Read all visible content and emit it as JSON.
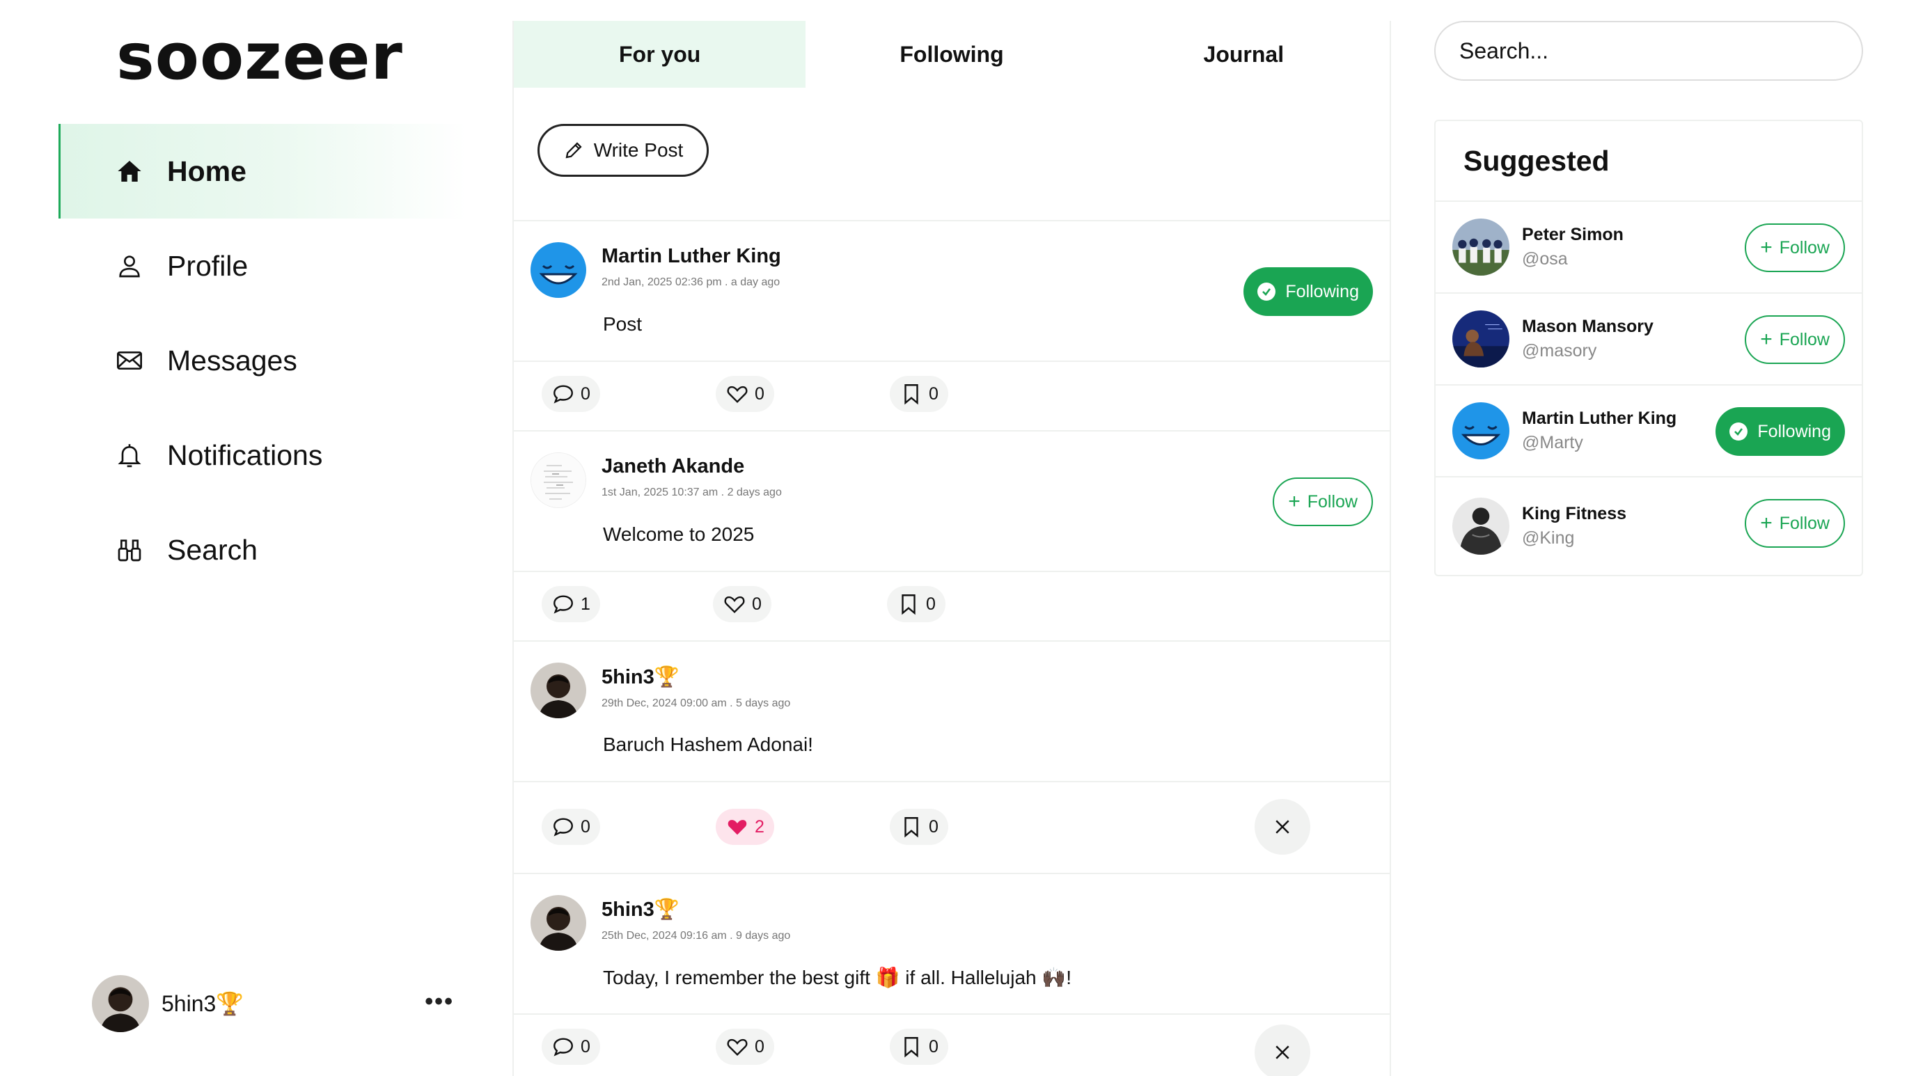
{
  "app": {
    "logo": "soozeer"
  },
  "nav": {
    "items": [
      {
        "label": "Home",
        "icon": "home-icon",
        "active": true
      },
      {
        "label": "Profile",
        "icon": "user-icon",
        "active": false
      },
      {
        "label": "Messages",
        "icon": "envelope-icon",
        "active": false
      },
      {
        "label": "Notifications",
        "icon": "bell-icon",
        "active": false
      },
      {
        "label": "Search",
        "icon": "binoculars-icon",
        "active": false
      }
    ]
  },
  "current_user": {
    "name": "5hin3🏆",
    "more": "•••"
  },
  "tabs": [
    {
      "label": "For you",
      "active": true
    },
    {
      "label": "Following",
      "active": false
    },
    {
      "label": "Journal",
      "active": false
    }
  ],
  "compose": {
    "write_label": "Write Post"
  },
  "posts": [
    {
      "author": "Martin Luther King",
      "time": "2nd Jan, 2025 02:36 pm . a day ago",
      "text": "Post",
      "action": "Following",
      "comments": "0",
      "likes": "0",
      "saves": "0",
      "liked": false,
      "closable": false
    },
    {
      "author": "Janeth Akande",
      "time": "1st Jan, 2025 10:37 am . 2 days ago",
      "text": "Welcome to 2025",
      "action": "Follow",
      "comments": "1",
      "likes": "0",
      "saves": "0",
      "liked": false,
      "closable": false
    },
    {
      "author": "5hin3🏆",
      "time": "29th Dec, 2024 09:00 am . 5 days ago",
      "text": "Baruch Hashem Adonai!",
      "action": "",
      "comments": "0",
      "likes": "2",
      "saves": "0",
      "liked": true,
      "closable": true
    },
    {
      "author": "5hin3🏆",
      "time": "25th Dec, 2024 09:16 am . 9 days ago",
      "text": "Today, I remember the best gift 🎁 if all. Hallelujah 🙌🏿!",
      "action": "",
      "comments": "0",
      "likes": "0",
      "saves": "0",
      "liked": false,
      "closable": true
    }
  ],
  "search": {
    "placeholder": "Search..."
  },
  "suggested": {
    "title": "Suggested",
    "users": [
      {
        "name": "Peter Simon",
        "handle": "@osa",
        "action": "Follow"
      },
      {
        "name": "Mason Mansory",
        "handle": "@masory",
        "action": "Follow"
      },
      {
        "name": "Martin Luther King",
        "handle": "@Marty",
        "action": "Following"
      },
      {
        "name": "King Fitness",
        "handle": "@King",
        "action": "Follow"
      }
    ]
  },
  "colors": {
    "accent": "#1aa553",
    "active_tab_bg": "#e9f8ef",
    "like": "#e31d63"
  }
}
